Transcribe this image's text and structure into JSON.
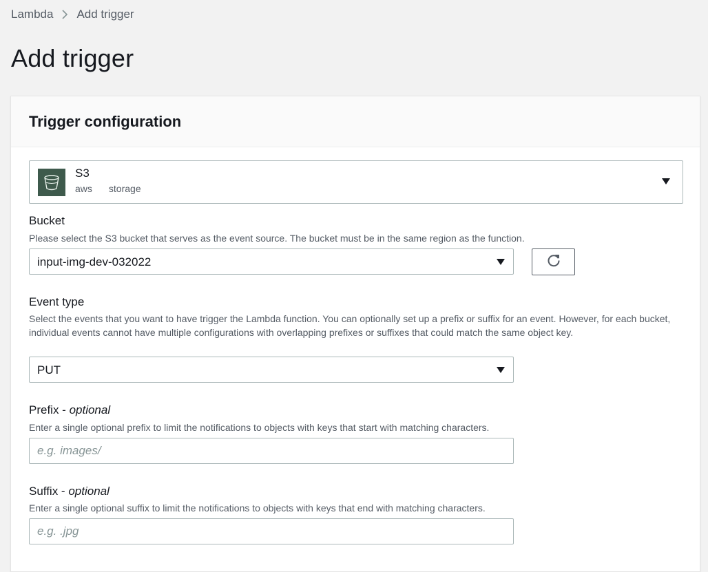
{
  "breadcrumb": {
    "items": [
      "Lambda",
      "Add trigger"
    ]
  },
  "page": {
    "title": "Add trigger"
  },
  "panel": {
    "title": "Trigger configuration"
  },
  "trigger": {
    "name": "S3",
    "tags": [
      "aws",
      "storage"
    ],
    "icon": "s3-bucket-icon"
  },
  "bucket": {
    "label": "Bucket",
    "description": "Please select the S3 bucket that serves as the event source. The bucket must be in the same region as the function.",
    "value": "input-img-dev-032022"
  },
  "event_type": {
    "label": "Event type",
    "description": "Select the events that you want to have trigger the Lambda function. You can optionally set up a prefix or suffix for an event. However, for each bucket, individual events cannot have multiple configurations with overlapping prefixes or suffixes that could match the same object key.",
    "value": "PUT"
  },
  "prefix": {
    "label": "Prefix - ",
    "optional": "optional",
    "description": "Enter a single optional prefix to limit the notifications to objects with keys that start with matching characters.",
    "placeholder": "e.g. images/",
    "value": ""
  },
  "suffix": {
    "label": "Suffix - ",
    "optional": "optional",
    "description": "Enter a single optional suffix to limit the notifications to objects with keys that end with matching characters.",
    "placeholder": "e.g. .jpg",
    "value": ""
  },
  "colors": {
    "s3_tile": "#3e5a4c",
    "border": "#aab7b8",
    "text_secondary": "#545b64"
  }
}
